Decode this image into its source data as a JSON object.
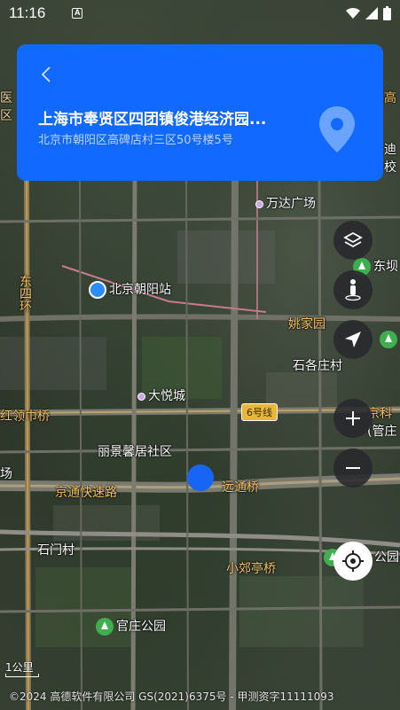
{
  "status_bar": {
    "time": "11:16",
    "notification_icon": "A"
  },
  "header": {
    "back_icon": "chevron-left",
    "title": "上海市奉贤区四团镇俊港经济园...",
    "subtitle": "北京市朝阳区高碑店村三区50号楼5号",
    "pin_icon": "location-pin"
  },
  "map": {
    "labels": {
      "wanda": "万达广场",
      "chaoyang_station": "北京朝阳站",
      "yaojia_garden": "姚家园",
      "shigezhuang": "石各庄村",
      "dongyue": "大悦城",
      "hongling_bridge": "红领巾桥",
      "line6": "6号线",
      "lijing": "丽景馨居社区",
      "jingtong_expressway": "京通快速路",
      "yuantong_bridge": "远通桥",
      "shimen": "石门村",
      "xiaojiaoting_bridge": "小郊亭桥",
      "guanzhuang_park": "官庄公园",
      "dong4huan": "东四环",
      "donghu": "东坝",
      "jingke": "京科",
      "guanzhuang_short": "(管庄",
      "park_right": "公园",
      "field_left": "场",
      "left_hospital": "医",
      "left_x": "区",
      "right_gao": "高",
      "right_di": "迪",
      "right_xiao": "校"
    }
  },
  "controls": {
    "layers": "layers-icon",
    "walk": "pedestrian-icon",
    "compass": "navigation-arrow-icon",
    "zoom_in": "plus-icon",
    "zoom_out": "minus-icon",
    "locate": "crosshair-icon"
  },
  "scale": "1公里",
  "copyright": "©2024 高德软件有限公司 GS(2021)6375号 - 甲测资字11111093"
}
